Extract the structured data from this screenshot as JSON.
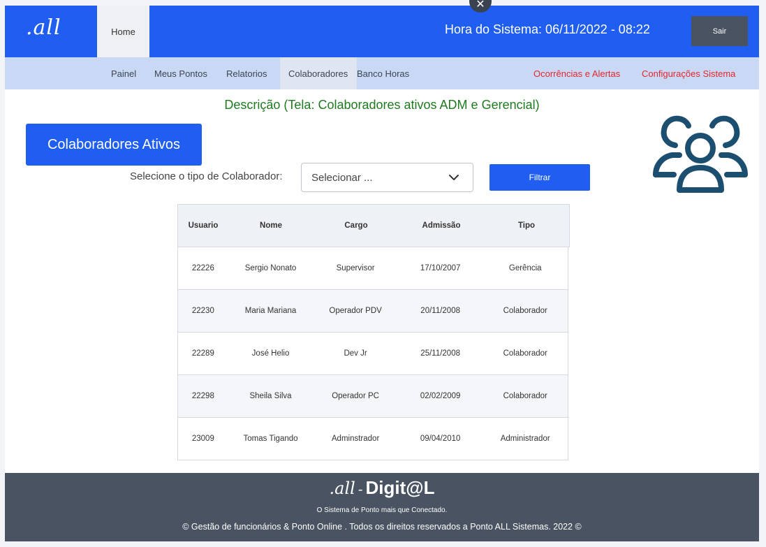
{
  "header": {
    "logo": ".all",
    "home_tab": "Home",
    "system_time": "Hora do Sistema: 06/11/2022  -  08:22",
    "logout_label": "Sair"
  },
  "nav": {
    "items": [
      "Painel",
      "Meus Pontos",
      "Relatorios",
      "Colaboradores",
      "Banco Horas"
    ],
    "active": "Colaboradores",
    "right_items": [
      "Ocorrências e Alertas",
      "Configurações Sistema"
    ]
  },
  "page": {
    "description": "Descrição (Tela: Colaboradores ativos ADM e Gerencial)",
    "main_button": "Colaboradores Ativos",
    "select_label": "Selecione o tipo de Colaborador:",
    "select_value": "Selecionar ...",
    "filter_button": "Filtrar"
  },
  "table": {
    "headers": [
      "Usuario",
      "Nome",
      "Cargo",
      "Admissão",
      "Tipo"
    ],
    "rows": [
      [
        "22226",
        "Sergio Nonato",
        "Supervisor",
        "17/10/2007",
        "Gerência"
      ],
      [
        "22230",
        "Maria Mariana",
        "Operador PDV",
        "20/11/2008",
        "Colaborador"
      ],
      [
        "22289",
        "José Helio",
        "Dev Jr",
        "25/11/2008",
        "Colaborador"
      ],
      [
        "22298",
        "Sheila Silva",
        "Operador PC",
        "02/02/2009",
        "Colaborador"
      ],
      [
        "23009",
        "Tomas Tigando",
        "Adminstrador",
        "09/04/2010",
        "Administrador"
      ]
    ]
  },
  "footer": {
    "logo_script": ".all",
    "logo_dash": "-",
    "logo_brand": "Digit@L",
    "tagline": "O Sistema de Ponto mais que Conectado.",
    "copyright": "© Gestão de funcionários & Ponto Online .  Todos os direitos reservados a Ponto ALL Sistemas.   2022 ©"
  },
  "colors": {
    "primary": "#1f5ef0",
    "subnav": "#c9d8f5",
    "alert": "#e4262c",
    "description": "#1f7a1f",
    "footer": "#4a5361",
    "icon": "#1c4e6f"
  },
  "icons": {
    "close": "close-icon",
    "users": "users-group-icon",
    "chevron": "chevron-down-icon"
  }
}
